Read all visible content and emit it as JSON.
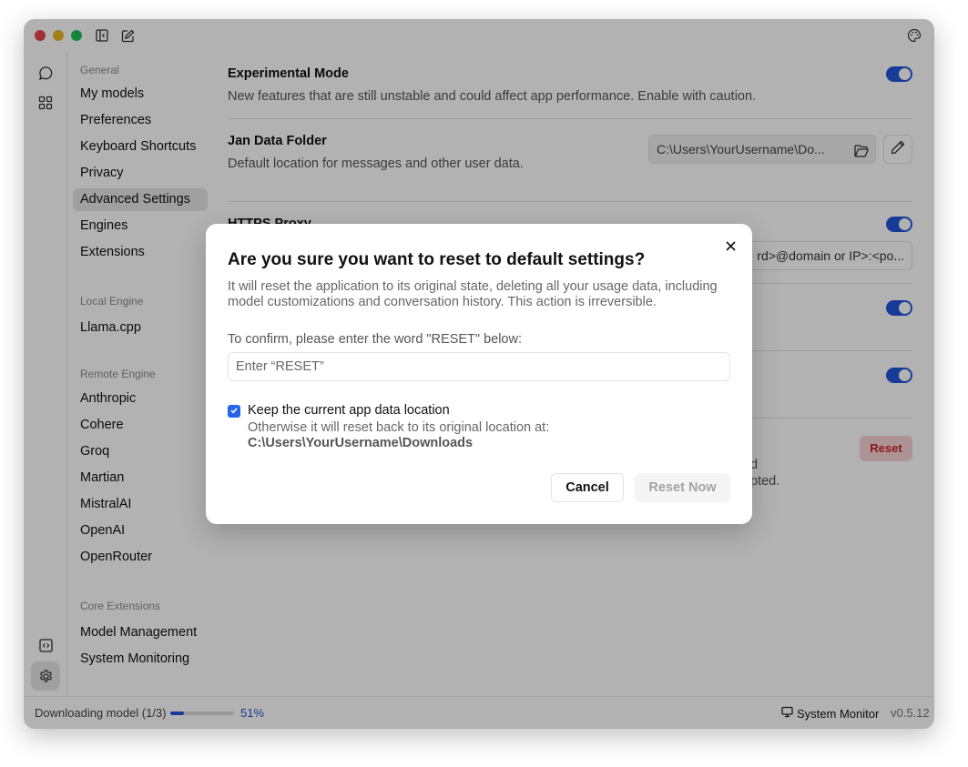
{
  "titlebar": {
    "icons": [
      "sidebar-toggle-icon",
      "new-chat-icon",
      "palette-icon"
    ]
  },
  "iconbar": {
    "top": [
      "chat-icon",
      "hub-grid-icon"
    ],
    "bottom": [
      "api-server-icon",
      "settings-gear-icon"
    ]
  },
  "sidebar": {
    "groups": [
      {
        "label": "General",
        "items": [
          "My models",
          "Preferences",
          "Keyboard Shortcuts",
          "Privacy",
          "Advanced Settings",
          "Engines",
          "Extensions"
        ]
      },
      {
        "label": "Local Engine",
        "items": [
          "Llama.cpp"
        ]
      },
      {
        "label": "Remote Engine",
        "items": [
          "Anthropic",
          "Cohere",
          "Groq",
          "Martian",
          "MistralAI",
          "OpenAI",
          "OpenRouter"
        ]
      },
      {
        "label": "Core Extensions",
        "items": [
          "Model Management",
          "System Monitoring"
        ]
      }
    ],
    "active": "Advanced Settings"
  },
  "main": {
    "experimental": {
      "title": "Experimental Mode",
      "desc": "New features that are still unstable and could affect app performance. Enable with caution.",
      "enabled": true
    },
    "data_folder": {
      "title": "Jan Data Folder",
      "desc": "Default location for messages and other user data.",
      "value": "C:\\Users\\YourUsername\\Do..."
    },
    "https_proxy": {
      "title": "HTTPS Proxy",
      "enabled": true,
      "value": "rd>@domain or IP>:<po..."
    },
    "toggle3_enabled": true,
    "toggle4_enabled": true,
    "reset": {
      "button": "Reset",
      "desc_tail_1": "d",
      "desc_tail_2": "pted."
    }
  },
  "statusbar": {
    "download_label": "Downloading model (1/3)",
    "progress_percent": 51,
    "progress_text": "51%",
    "system_monitor": "System Monitor",
    "version": "v0.5.12"
  },
  "modal": {
    "title": "Are you sure you want to reset to default settings?",
    "desc": "It will reset the application to its original state, deleting all your usage data, including model customizations and conversation history. This action is irreversible.",
    "confirm_label": "To confirm, please enter the word \"RESET\" below:",
    "input_placeholder": "Enter “RESET”",
    "input_value": "",
    "keep_location_checked": true,
    "keep_location_label": "Keep the current app data location",
    "keep_location_sub": "Otherwise it will reset back to its original location at:",
    "original_path": "C:\\Users\\YourUsername\\Downloads",
    "cancel_label": "Cancel",
    "reset_label": "Reset Now"
  },
  "colors": {
    "accent": "#2156d9",
    "danger": "#c82525",
    "traffic_red": "#e5484d",
    "traffic_yellow": "#e5b82a",
    "traffic_green": "#1fbf5a"
  }
}
